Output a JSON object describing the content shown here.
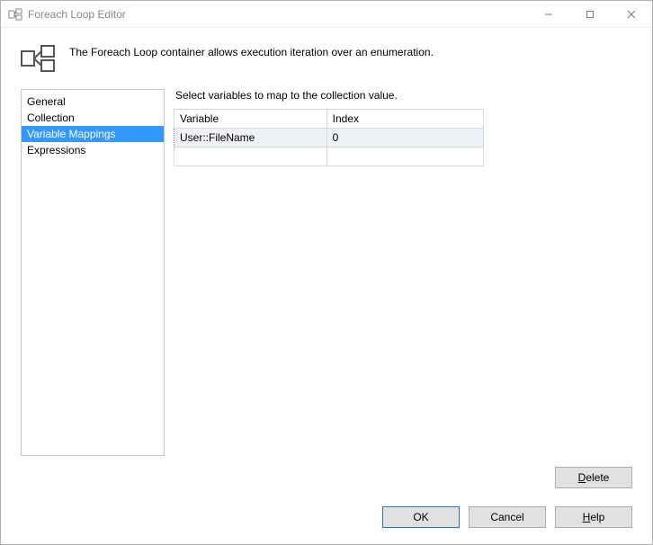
{
  "window": {
    "title": "Foreach Loop Editor"
  },
  "header": {
    "description": "The Foreach Loop container allows execution iteration over an enumeration."
  },
  "nav": {
    "items": [
      {
        "label": "General",
        "selected": false
      },
      {
        "label": "Collection",
        "selected": false
      },
      {
        "label": "Variable Mappings",
        "selected": true
      },
      {
        "label": "Expressions",
        "selected": false
      }
    ]
  },
  "main": {
    "instruction": "Select variables to map to the collection value.",
    "columns": {
      "variable": "Variable",
      "index": "Index"
    },
    "rows": [
      {
        "variable": "User::FileName",
        "index": "0"
      }
    ]
  },
  "buttons": {
    "delete": "Delete",
    "ok": "OK",
    "cancel": "Cancel",
    "help": "Help"
  }
}
